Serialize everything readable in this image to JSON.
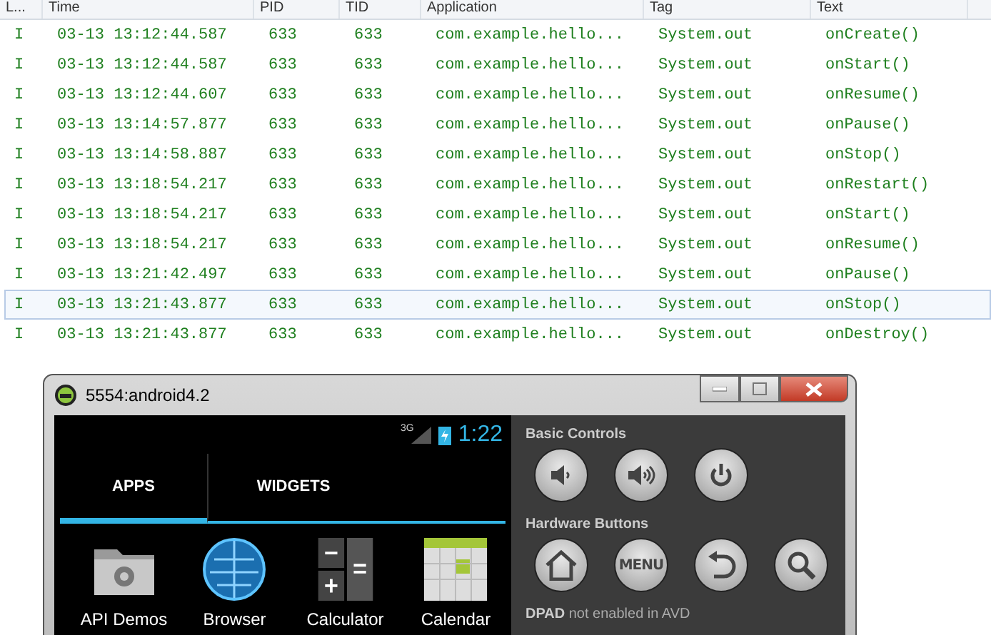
{
  "log_table": {
    "columns": [
      "L...",
      "Time",
      "PID",
      "TID",
      "Application",
      "Tag",
      "Text"
    ],
    "rows": [
      {
        "cells": [
          "I",
          "03-13 13:12:44.587",
          "633",
          "633",
          "com.example.hello...",
          "System.out",
          "onCreate()"
        ],
        "selected": false
      },
      {
        "cells": [
          "I",
          "03-13 13:12:44.587",
          "633",
          "633",
          "com.example.hello...",
          "System.out",
          "onStart()"
        ],
        "selected": false
      },
      {
        "cells": [
          "I",
          "03-13 13:12:44.607",
          "633",
          "633",
          "com.example.hello...",
          "System.out",
          "onResume()"
        ],
        "selected": false
      },
      {
        "cells": [
          "I",
          "03-13 13:14:57.877",
          "633",
          "633",
          "com.example.hello...",
          "System.out",
          "onPause()"
        ],
        "selected": false
      },
      {
        "cells": [
          "I",
          "03-13 13:14:58.887",
          "633",
          "633",
          "com.example.hello...",
          "System.out",
          "onStop()"
        ],
        "selected": false
      },
      {
        "cells": [
          "I",
          "03-13 13:18:54.217",
          "633",
          "633",
          "com.example.hello...",
          "System.out",
          "onRestart()"
        ],
        "selected": false
      },
      {
        "cells": [
          "I",
          "03-13 13:18:54.217",
          "633",
          "633",
          "com.example.hello...",
          "System.out",
          "onStart()"
        ],
        "selected": false
      },
      {
        "cells": [
          "I",
          "03-13 13:18:54.217",
          "633",
          "633",
          "com.example.hello...",
          "System.out",
          "onResume()"
        ],
        "selected": false
      },
      {
        "cells": [
          "I",
          "03-13 13:21:42.497",
          "633",
          "633",
          "com.example.hello...",
          "System.out",
          "onPause()"
        ],
        "selected": false
      },
      {
        "cells": [
          "I",
          "03-13 13:21:43.877",
          "633",
          "633",
          "com.example.hello...",
          "System.out",
          "onStop()"
        ],
        "selected": true
      },
      {
        "cells": [
          "I",
          "03-13 13:21:43.877",
          "633",
          "633",
          "com.example.hello...",
          "System.out",
          "onDestroy()"
        ],
        "selected": false
      }
    ]
  },
  "emulator": {
    "title": "5554:android4.2",
    "status_bar": {
      "network": "3G",
      "time": "1:22"
    },
    "tabs": [
      {
        "label": "APPS",
        "selected": true
      },
      {
        "label": "WIDGETS",
        "selected": false
      }
    ],
    "apps": [
      {
        "label": "API Demos",
        "kind": "folder"
      },
      {
        "label": "Browser",
        "kind": "globe"
      },
      {
        "label": "Calculator",
        "kind": "calculator"
      },
      {
        "label": "Calendar",
        "kind": "calendar"
      }
    ],
    "basic_controls": {
      "title": "Basic Controls",
      "buttons": [
        {
          "kind": "volume-down"
        },
        {
          "kind": "volume-up"
        },
        {
          "kind": "power"
        }
      ]
    },
    "hardware_buttons": {
      "title": "Hardware Buttons",
      "buttons": [
        {
          "kind": "home"
        },
        {
          "kind": "menu",
          "label": "MENU"
        },
        {
          "kind": "back"
        },
        {
          "kind": "search"
        }
      ]
    },
    "dpad_note": "**DPAD** not enabled in AVD"
  }
}
